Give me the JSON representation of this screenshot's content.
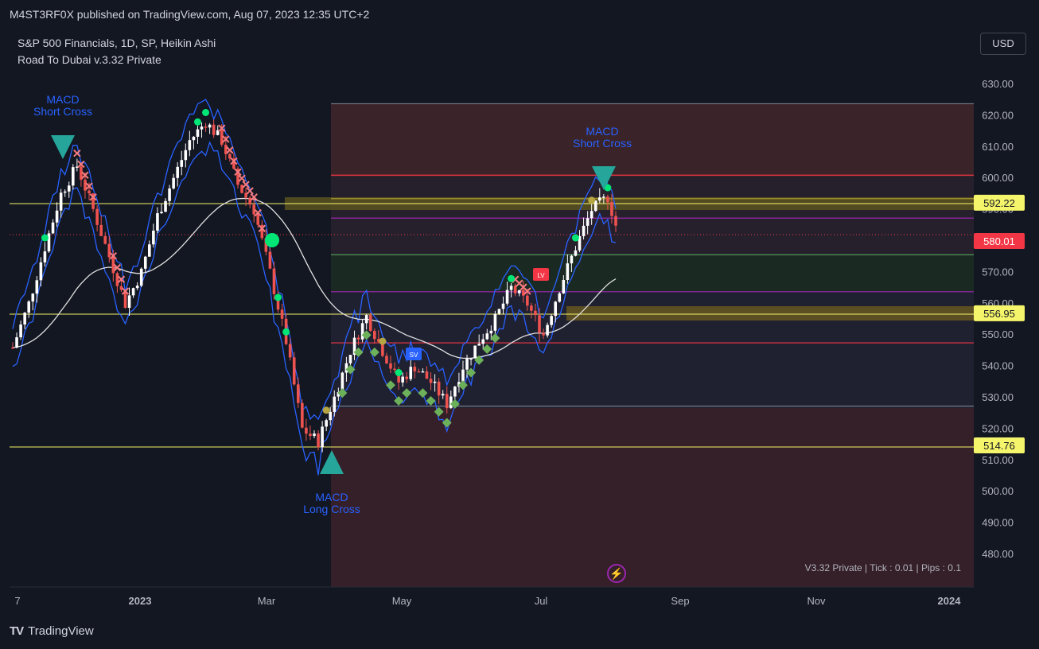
{
  "header": {
    "published": "M4ST3RF0X published on TradingView.com, Aug 07, 2023 12:35 UTC+2"
  },
  "legend": {
    "symbol": "S&P 500 Financials, 1D, SP, Heikin Ashi",
    "indicator": "Road To Dubai v.3.32 Private"
  },
  "currency_button": "USD",
  "footer": {
    "brand": "TradingView"
  },
  "status_text": "V3.32 Private | Tick : 0.01 | Pips : 0.1",
  "colors": {
    "background": "#131722",
    "up_candle": "#ffffff",
    "down_candle": "#ef5350",
    "band": "#2962ff",
    "ma": "#e0e0e0",
    "label_yellow": "#f5f56b",
    "label_red": "#f23645",
    "teal": "#26a69a"
  },
  "annotations": {
    "macd_short_1": [
      "MACD",
      "Short Cross"
    ],
    "macd_long": [
      "MACD",
      "Long Cross"
    ],
    "macd_short_2": [
      "MACD",
      "Short Cross"
    ],
    "lv_badge": "LV",
    "sv_badge": "SV"
  },
  "chart_data": {
    "type": "candlestick",
    "title": "S&P 500 Financials, 1D, SP, Heikin Ashi",
    "y_ticks": [
      630,
      620,
      610,
      600,
      590,
      580,
      570,
      560,
      550,
      540,
      530,
      520,
      510,
      500,
      490,
      480
    ],
    "y_tick_labels": [
      "630.00",
      "620.00",
      "610.00",
      "600.00",
      "590.00",
      "580.00",
      "570.00",
      "560.00",
      "550.00",
      "540.00",
      "530.00",
      "520.00",
      "510.00",
      "500.00",
      "490.00",
      "480.00"
    ],
    "x_tick_labels": [
      "7",
      "2023",
      "Mar",
      "May",
      "Jul",
      "Sep",
      "Nov",
      "2024"
    ],
    "ylim": [
      474,
      636
    ],
    "price_labels": [
      {
        "value": 592.22,
        "text": "592.22",
        "color": "#f5f56b"
      },
      {
        "value": 580.01,
        "text": "580.01",
        "color": "#f23645"
      },
      {
        "value": 556.95,
        "text": "556.95",
        "color": "#f5f56b"
      },
      {
        "value": 514.76,
        "text": "514.76",
        "color": "#f5f56b"
      }
    ],
    "levels": [
      {
        "value": 623.8,
        "color": "#787b86"
      },
      {
        "value": 601.0,
        "color": "#f23645"
      },
      {
        "value": 593.5,
        "color": "#b2a22b"
      },
      {
        "value": 587.3,
        "color": "#9c27b0"
      },
      {
        "value": 575.6,
        "color": "#4caf50"
      },
      {
        "value": 563.8,
        "color": "#9c27b0"
      },
      {
        "value": 547.5,
        "color": "#f23645"
      },
      {
        "value": 527.3,
        "color": "#787b86"
      }
    ],
    "series": [
      {
        "name": "",
        "points": [
          [
            0,
            546
          ],
          [
            4,
            560
          ],
          [
            8,
            578
          ],
          [
            12,
            595
          ],
          [
            16,
            604
          ],
          [
            20,
            590
          ],
          [
            24,
            575
          ],
          [
            28,
            560
          ],
          [
            32,
            570
          ],
          [
            36,
            588
          ],
          [
            40,
            600
          ],
          [
            44,
            612
          ],
          [
            48,
            618
          ],
          [
            52,
            612
          ],
          [
            56,
            598
          ],
          [
            60,
            590
          ],
          [
            64,
            570
          ],
          [
            68,
            548
          ],
          [
            72,
            520
          ],
          [
            76,
            516
          ],
          [
            80,
            530
          ],
          [
            84,
            545
          ],
          [
            88,
            556
          ],
          [
            92,
            545
          ],
          [
            96,
            535
          ],
          [
            100,
            540
          ],
          [
            104,
            535
          ],
          [
            108,
            528
          ],
          [
            112,
            540
          ],
          [
            116,
            548
          ],
          [
            120,
            555
          ],
          [
            124,
            565
          ],
          [
            128,
            560
          ],
          [
            132,
            550
          ],
          [
            136,
            565
          ],
          [
            140,
            578
          ],
          [
            144,
            590
          ],
          [
            148,
            594
          ],
          [
            150,
            585
          ]
        ]
      }
    ]
  }
}
